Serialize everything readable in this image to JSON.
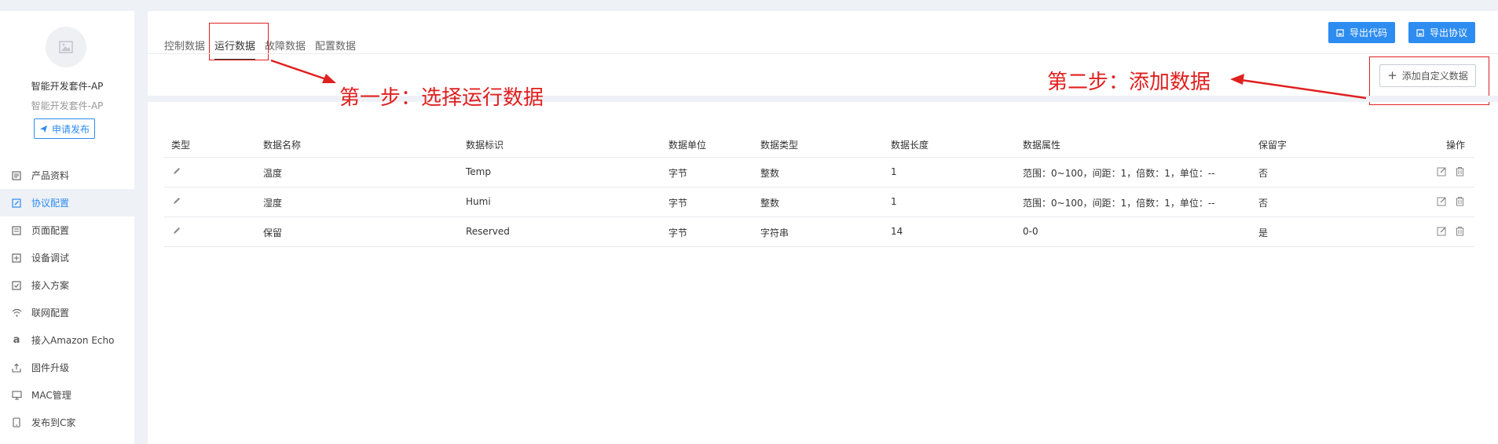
{
  "product": {
    "name": "智能开发套件-AP",
    "subtitle": "智能开发套件-AP",
    "apply_label": "申请发布"
  },
  "menu": [
    {
      "label": "产品资料",
      "icon": "document-icon",
      "active": false
    },
    {
      "label": "协议配置",
      "icon": "edit-square-icon",
      "active": true
    },
    {
      "label": "页面配置",
      "icon": "page-icon",
      "active": false
    },
    {
      "label": "设备调试",
      "icon": "debug-icon",
      "active": false
    },
    {
      "label": "接入方案",
      "icon": "check-square-icon",
      "active": false
    },
    {
      "label": "联网配置",
      "icon": "wifi-icon",
      "active": false
    },
    {
      "label": "接入Amazon Echo",
      "icon": "amazon-icon",
      "active": false
    },
    {
      "label": "固件升级",
      "icon": "upload-icon",
      "active": false
    },
    {
      "label": "MAC管理",
      "icon": "monitor-icon",
      "active": false
    },
    {
      "label": "发布到C家",
      "icon": "phone-icon",
      "active": false
    }
  ],
  "tabs": [
    {
      "label": "控制数据",
      "active": false
    },
    {
      "label": "运行数据",
      "active": true
    },
    {
      "label": "故障数据",
      "active": false
    },
    {
      "label": "配置数据",
      "active": false
    }
  ],
  "toolbar": {
    "export_code": "导出代码",
    "export_protocol": "导出协议",
    "add_custom": "添加自定义数据"
  },
  "annotations": {
    "step1": "第一步：选择运行数据",
    "step2": "第二步：添加数据"
  },
  "table": {
    "headers": [
      "类型",
      "数据名称",
      "数据标识",
      "数据单位",
      "数据类型",
      "数据长度",
      "数据属性",
      "保留字",
      "操作"
    ],
    "rows": [
      [
        "温度",
        "Temp",
        "字节",
        "整数",
        "1",
        "范围：0~100，间距：1，倍数：1，单位：--",
        "否"
      ],
      [
        "湿度",
        "Humi",
        "字节",
        "整数",
        "1",
        "范围：0~100，间距：1，倍数：1，单位：--",
        "否"
      ],
      [
        "保留",
        "Reserved",
        "字节",
        "字符串",
        "14",
        "0-0",
        "是"
      ]
    ]
  },
  "colors": {
    "primary": "#2d8cf0",
    "annotation": "#e0201f",
    "background": "#eef1f6"
  }
}
